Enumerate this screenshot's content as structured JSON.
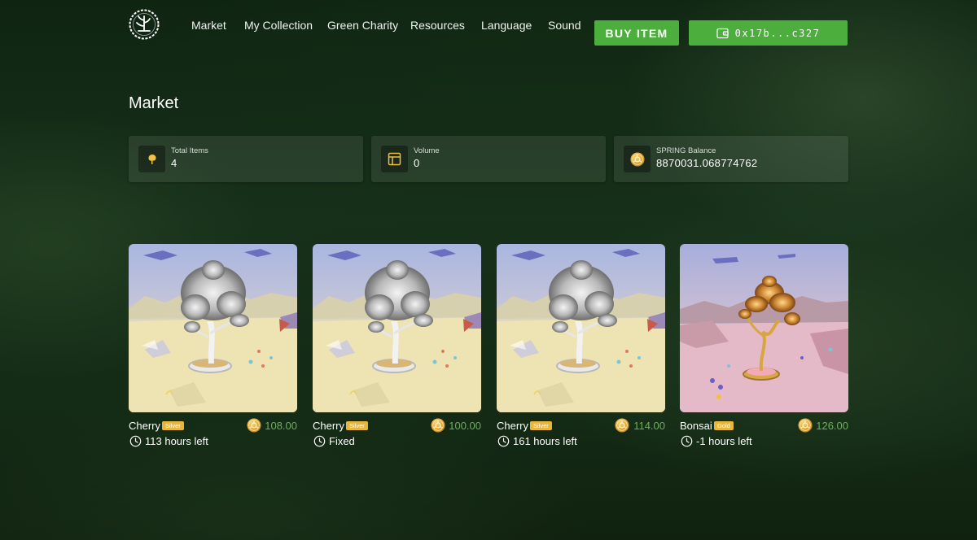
{
  "nav": {
    "links": [
      "Market",
      "My Collection",
      "Green Charity",
      "Resources",
      "Language",
      "Sound"
    ],
    "buy_label": "BUY ITEM",
    "wallet_label": "0x17b...c327"
  },
  "page": {
    "title": "Market"
  },
  "stats": [
    {
      "label": "Total Items",
      "value": "4",
      "icon": "tree-icon"
    },
    {
      "label": "Volume",
      "value": "0",
      "icon": "layout-icon"
    },
    {
      "label": "SPRING Balance",
      "value": "8870031.068774762",
      "icon": "coin-icon"
    }
  ],
  "items": [
    {
      "name": "Cherry",
      "tier": "Silver",
      "price": "108.00",
      "time": "113 hours left",
      "image": "silver-cherry-tree"
    },
    {
      "name": "Cherry",
      "tier": "Silver",
      "price": "100.00",
      "time": "Fixed",
      "image": "silver-cherry-tree"
    },
    {
      "name": "Cherry",
      "tier": "Silver",
      "price": "114.00",
      "time": "161 hours left",
      "image": "silver-cherry-tree"
    },
    {
      "name": "Bonsai",
      "tier": "Gold",
      "price": "126.00",
      "time": "-1 hours left",
      "image": "gold-bonsai-tree"
    }
  ],
  "colors": {
    "accent": "#4cae3c",
    "price": "#6bb05b",
    "badge": "#e8b73a",
    "coin": "#e0a42a"
  }
}
